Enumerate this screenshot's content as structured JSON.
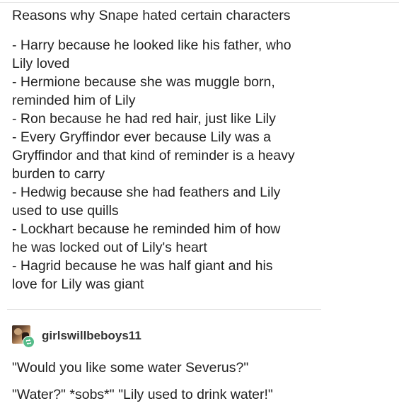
{
  "post": {
    "title": "Reasons why Snape hated certain characters",
    "lines": [
      "- Harry because he looked like his father, who",
      "Lily loved",
      "- Hermione because she was muggle born,",
      "reminded him of Lily",
      "- Ron because he had red hair, just like Lily",
      "- Every Gryffindor ever because Lily was a",
      "Gryffindor and that kind of reminder is a heavy",
      "burden to carry",
      "- Hedwig because she had feathers and Lily",
      "used to use quills",
      "- Lockhart because he reminded him of how",
      "he was locked out of Lily's heart",
      "- Hagrid because he was half giant and his",
      "love for Lily was giant"
    ]
  },
  "reply": {
    "username": "girlswillbeboys11",
    "avatar_icon": "user-avatar",
    "badge_icon": "reblog-icon",
    "badge_color": "#56bc8a",
    "quotes": [
      "\"Would you like some water Severus?\"",
      "\"Water?\" *sobs*\" \"Lily used to drink water!\""
    ]
  }
}
